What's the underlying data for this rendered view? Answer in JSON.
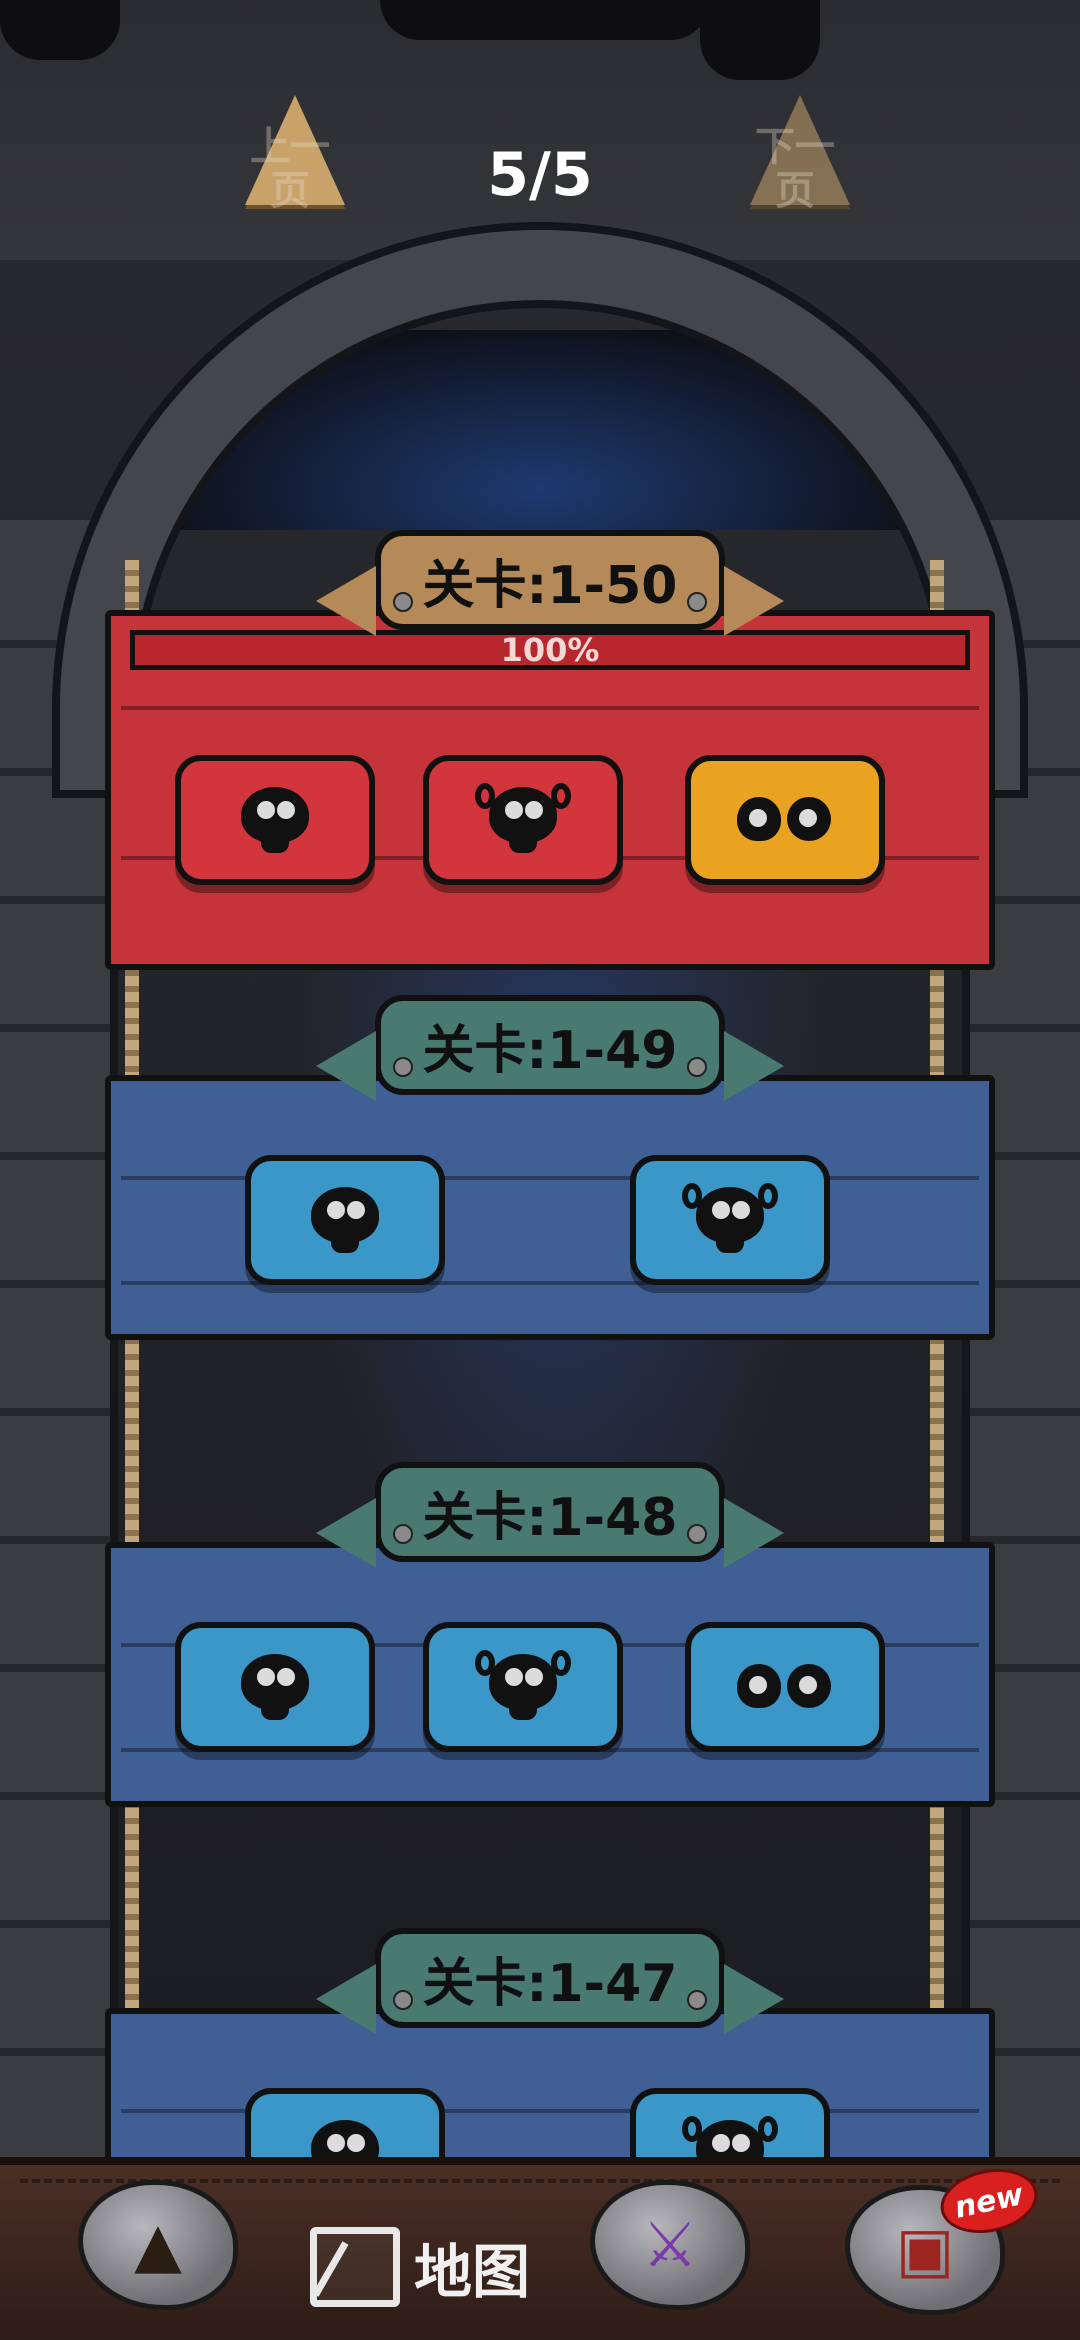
{
  "pager": {
    "prev_label": "上一页",
    "next_label": "下一页",
    "counter": "5/5"
  },
  "levels": [
    {
      "title": "关卡:1-50",
      "progress_text": "100%",
      "progress": 1.0,
      "color": "red",
      "cells": 3
    },
    {
      "title": "关卡:1-49",
      "color": "blue",
      "cells": 2
    },
    {
      "title": "关卡:1-48",
      "color": "blue",
      "cells": 3
    },
    {
      "title": "关卡:1-47",
      "color": "blue",
      "cells": 2
    }
  ],
  "bottom_nav": {
    "items": [
      {
        "name": "hero-nav",
        "icon": "plague-doctor-icon"
      },
      {
        "name": "map-nav",
        "icon": "map-icon",
        "label": "地图"
      },
      {
        "name": "battle-nav",
        "icon": "crossed-swords-icon"
      },
      {
        "name": "shop-nav",
        "icon": "chest-icon",
        "badge": "new"
      }
    ]
  },
  "colors": {
    "red": "#c5343a",
    "blue": "#3f5f95",
    "gold": "#e9a321",
    "cell_blue": "#3b97c8",
    "cell_red": "#d3353c"
  }
}
